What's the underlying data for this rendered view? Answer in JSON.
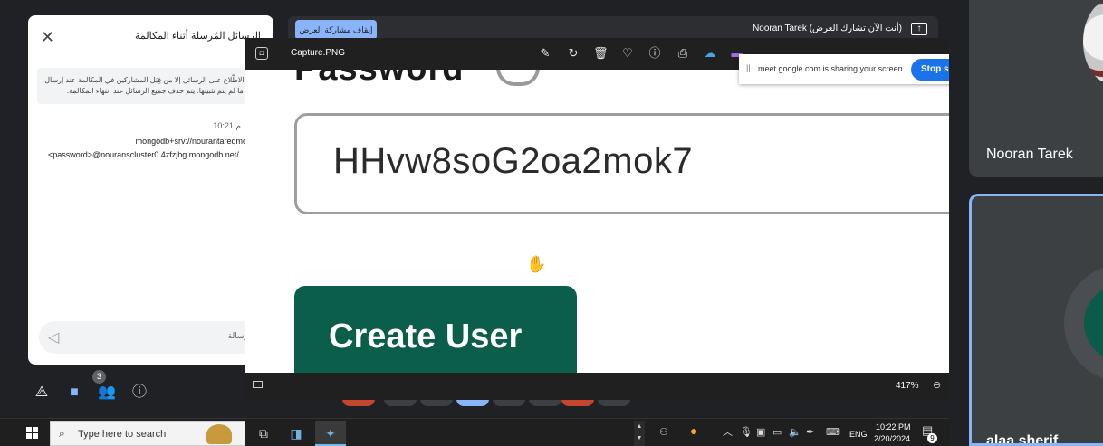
{
  "meet": {
    "presenting_text": "Nooran Tarek (أنت الآن تشارك العرض)",
    "stop_presenting_label": "إيقاف مشاركة العرض",
    "present_icon": "present-screen-icon",
    "participants": [
      {
        "name": "Nooran Tarek"
      },
      {
        "name": "alaa sherif"
      }
    ],
    "people_count": "3",
    "accent": "#8ab4f8"
  },
  "chat": {
    "title": "الرسائل المُرسلة أثناء المكالمة",
    "notice": "لا يمكن الاطّلاع على الرسائل إلا من قِبَل المشاركين في المكالمة عند إرسال الرسالة ما لم يتم تثبيتها. يتم حذف جميع الرسائل عند انتهاء المكالمة.",
    "message_time": "10:21 م",
    "message_line1": "mongodb+srv://nourantareqmohamed:",
    "message_line2": "<password>@nouranscluster0.4zfzjbg.mongodb.net/",
    "input_placeholder": "إرسال رسالة"
  },
  "viewer": {
    "file_name": "Capture.PNG",
    "zoom": "417%",
    "password_label": "Password",
    "password_value": "HHvw8soG2oa2mok7",
    "button_label": "Create User",
    "button_color": "#0b5e4a",
    "sharing_text": "meet.google.com is sharing your screen.",
    "stop_sharing_label": "Stop sharing"
  },
  "taskbar": {
    "search_placeholder": "Type here to search",
    "language": "ENG",
    "time": "10:22 PM",
    "date": "2/20/2024",
    "notification_count": "9"
  }
}
